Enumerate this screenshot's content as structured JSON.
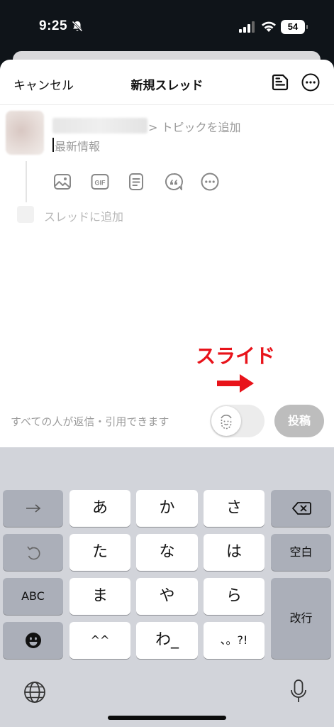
{
  "status_bar": {
    "time": "9:25",
    "battery": "54"
  },
  "header": {
    "cancel_label": "キャンセル",
    "title": "新規スレッド",
    "draft_icon": "drafts-icon",
    "more_icon": "more-icon"
  },
  "composer": {
    "topic_label": "> トピックを追加",
    "body_text": "最新情報",
    "tools": [
      "image-icon",
      "gif-icon",
      "document-icon",
      "quote-icon",
      "more-icon"
    ],
    "add_to_thread": "スレッドに追加"
  },
  "annotation": {
    "label": "スライド",
    "color": "#e8131a"
  },
  "footer": {
    "reply_setting": "すべての人が返信・引用できます",
    "post_label": "投稿"
  },
  "keyboard": {
    "row1": [
      "→",
      "あ",
      "か",
      "さ",
      "⌫"
    ],
    "row2": [
      "↺",
      "た",
      "な",
      "は",
      "空白"
    ],
    "row3": [
      "ABC",
      "ま",
      "や",
      "ら",
      "改行"
    ],
    "row4": [
      "☺",
      "^^",
      "わ_",
      "、。?!"
    ]
  }
}
